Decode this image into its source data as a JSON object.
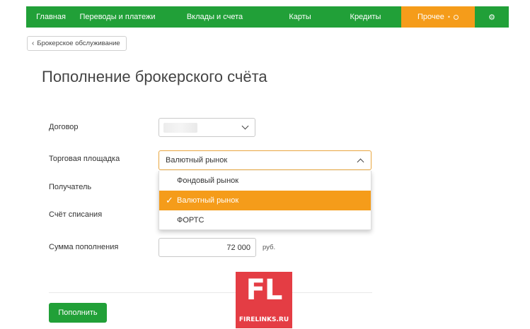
{
  "nav": {
    "items": [
      {
        "label": "Главная"
      },
      {
        "label": "Переводы и платежи"
      },
      {
        "label": "Вклады и счета"
      },
      {
        "label": "Карты"
      },
      {
        "label": "Кредиты"
      },
      {
        "label": "Прочее"
      }
    ],
    "settings_icon": "gear-icon",
    "accent_color": "#21a038",
    "highlight_color": "#f59c1a"
  },
  "breadcrumb": {
    "label": "Брокерское обслуживание",
    "icon": "chevron-left-icon"
  },
  "page": {
    "title": "Пополнение брокерского счёта"
  },
  "form": {
    "contract": {
      "label": "Договор",
      "value": ""
    },
    "market": {
      "label": "Торговая площадка",
      "value": "Валютный рынок",
      "options": [
        {
          "label": "Фондовый рынок",
          "selected": false
        },
        {
          "label": "Валютный рынок",
          "selected": true
        },
        {
          "label": "ФОРТС",
          "selected": false
        }
      ]
    },
    "recipient": {
      "label": "Получатель"
    },
    "debit_account": {
      "label": "Счёт списания"
    },
    "amount": {
      "label": "Сумма пополнения",
      "value": "72 000",
      "currency": "руб."
    },
    "submit_label": "Пополнить"
  },
  "watermark": {
    "big": "FL",
    "small": "FIRELINKS.RU"
  }
}
